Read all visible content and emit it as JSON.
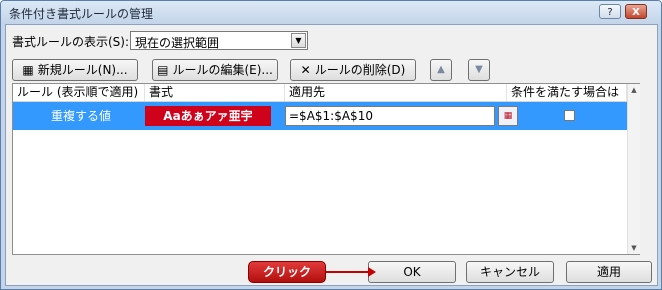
{
  "window": {
    "title": "条件付き書式ルールの管理",
    "help_label": "?",
    "close_label": "X"
  },
  "show_rules": {
    "label": "書式ルールの表示(S):",
    "value": "現在の選択範囲",
    "dropdown_glyph": "▼"
  },
  "toolbar": {
    "new_rule": "新規ルール(N)...",
    "edit_rule": "ルールの編集(E)...",
    "delete_rule": "ルールの削除(D)",
    "new_icon_glyph": "▦",
    "edit_icon_glyph": "▤",
    "delete_icon_glyph": "✕",
    "move_up_glyph": "▲",
    "move_down_glyph": "▼"
  },
  "grid": {
    "columns": [
      "ルール (表示順で適用)",
      "書式",
      "適用先",
      "条件を満たす場合は停止"
    ],
    "rows": [
      {
        "rule": "重複する値",
        "format_preview": "Aaあぁアァ亜宇",
        "applies_to": "=$A$1:$A$10",
        "stop_if_true": false,
        "range_button_glyph": "▦"
      }
    ],
    "scroll_up_glyph": "▲",
    "scroll_down_glyph": "▼"
  },
  "footer": {
    "ok": "OK",
    "cancel": "キャンセル",
    "apply": "適用"
  },
  "annotation": {
    "callout": "クリック"
  },
  "colors": {
    "selected_row": "#3399ff",
    "format_preview_bg": "#d0021b",
    "callout": "#c40000"
  }
}
